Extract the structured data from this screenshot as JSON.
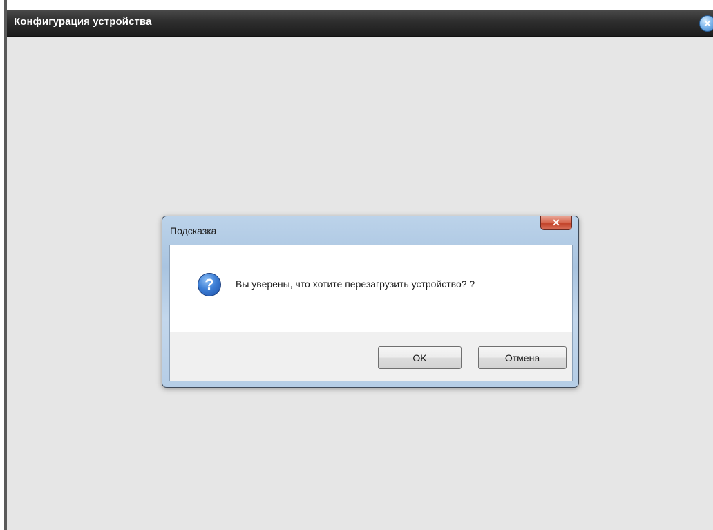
{
  "window": {
    "title": "Конфигурация устройства",
    "close_glyph": "✕",
    "close_icon": "close-circle-icon"
  },
  "dialog": {
    "title": "Подсказка",
    "close_glyph": "✕",
    "icon": "question-icon",
    "icon_glyph": "?",
    "message": "Вы уверены, что хотите перезагрузить устройство? ?",
    "ok_label": "OK",
    "cancel_label": "Отмена"
  },
  "colors": {
    "titlebar": "#2e2e2e",
    "body_bg": "#e6e6e6",
    "dialog_frame": "#b5cde6",
    "dialog_close": "#c2432a",
    "question_icon": "#3d7fd6"
  }
}
